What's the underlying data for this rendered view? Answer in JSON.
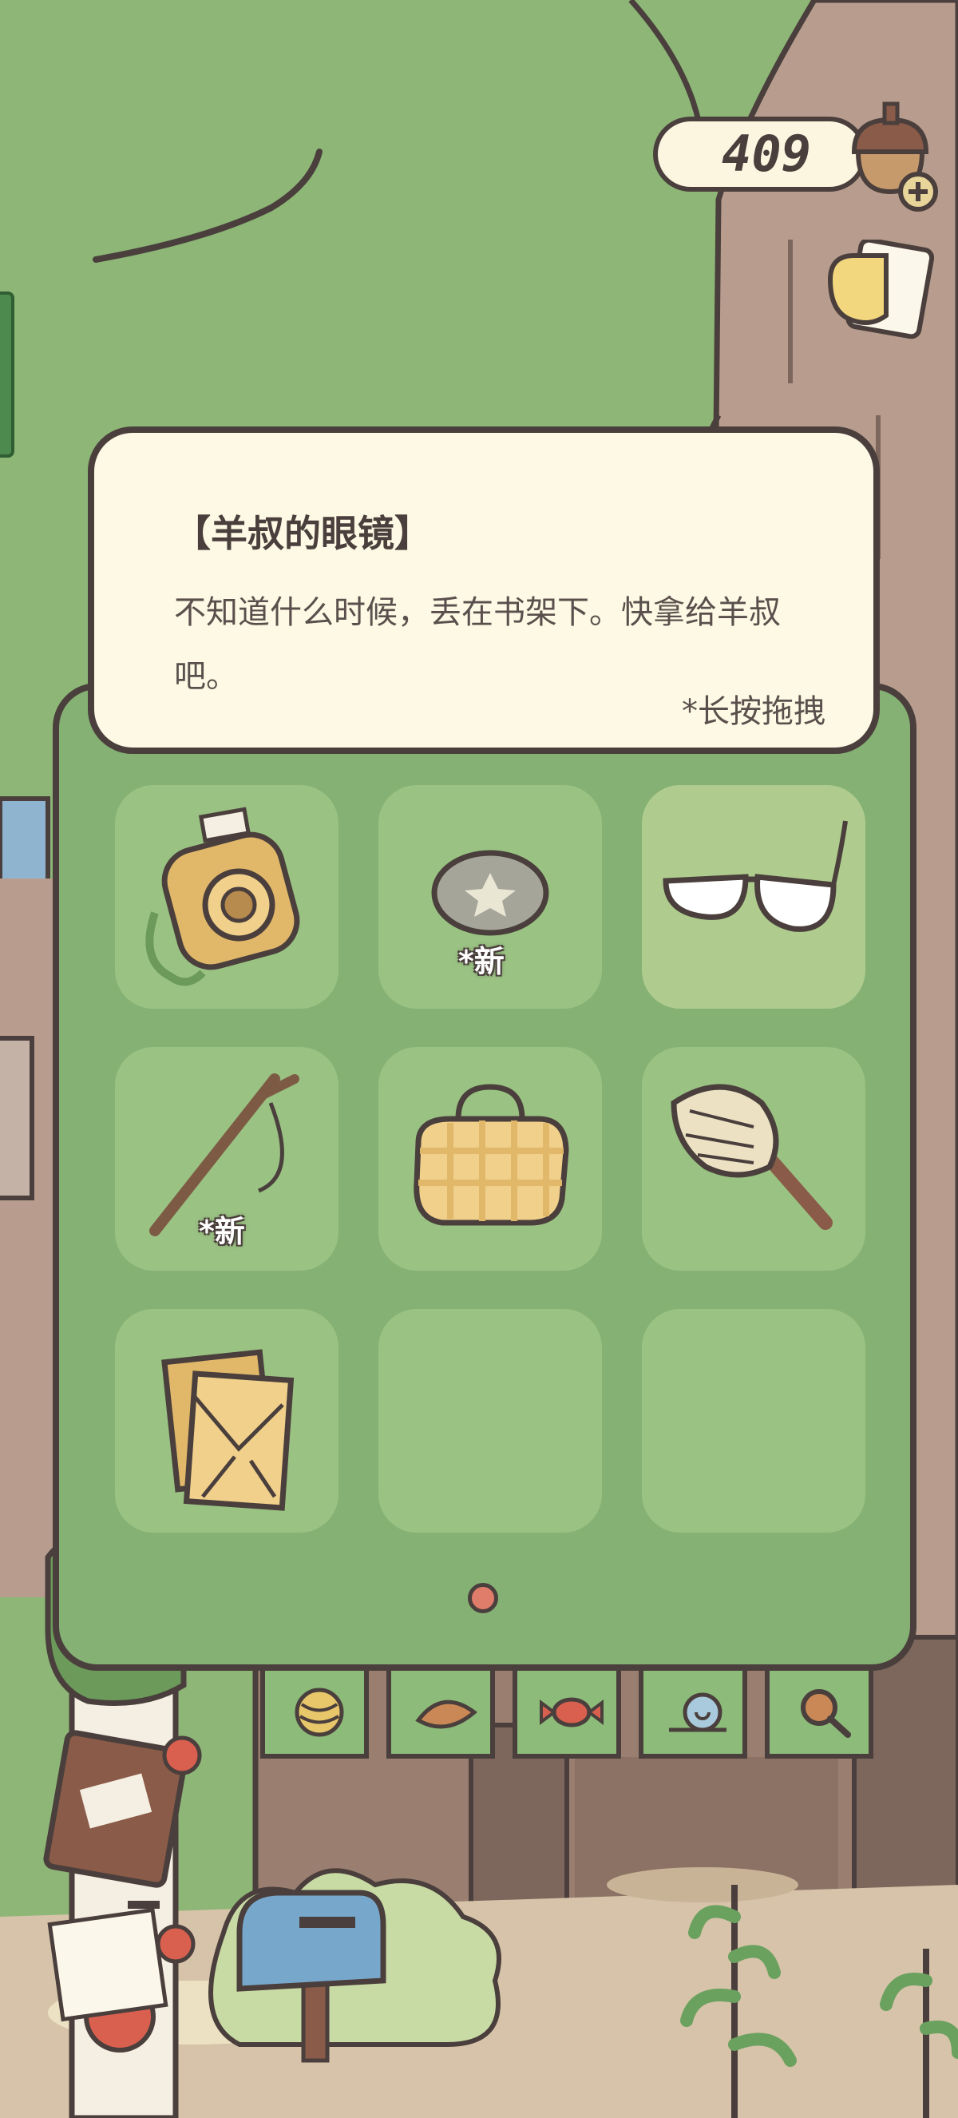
{
  "currency": {
    "value": "409",
    "icon": "acorn-icon",
    "add_icon": "plus-icon"
  },
  "item_detail": {
    "title": "【羊叔的眼镜】",
    "description": "不知道什么时候，丢在书架下。快拿给羊叔吧。",
    "hint": "*长按拖拽"
  },
  "inventory": {
    "items": [
      {
        "name": "camera-icon",
        "badge": ""
      },
      {
        "name": "flower-stone-icon",
        "badge": "*新"
      },
      {
        "name": "glasses-icon",
        "badge": "",
        "selected": true
      },
      {
        "name": "branch-icon",
        "badge": "*新"
      },
      {
        "name": "picnic-bag-icon",
        "badge": ""
      },
      {
        "name": "duster-icon",
        "badge": ""
      },
      {
        "name": "letters-icon",
        "badge": ""
      },
      {
        "name": "empty-slot",
        "badge": ""
      },
      {
        "name": "empty-slot",
        "badge": ""
      }
    ],
    "page": 1,
    "page_count": 1
  },
  "category_tabs": [
    "yarn-ball-icon",
    "leaf-icon",
    "candy-icon",
    "snail-icon",
    "magnifier-icon"
  ],
  "colors": {
    "panel": "#85b174",
    "slot": "#9ac283",
    "slot_selected": "#afcc8e",
    "tooltip": "#fdf9e4",
    "outline": "#4a3f3c",
    "page_dot": "#e07c6a"
  }
}
